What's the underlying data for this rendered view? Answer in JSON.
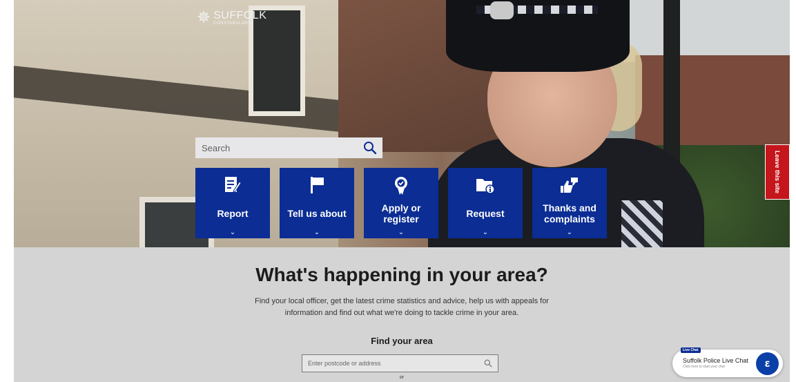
{
  "brand": {
    "name": "SUFFOLK",
    "subname": "CONSTABULARY",
    "crest_icon": "police-crest-icon"
  },
  "search": {
    "placeholder": "Search",
    "icon": "search-icon"
  },
  "tiles": [
    {
      "label": "Report",
      "icon": "report-form-icon"
    },
    {
      "label": "Tell us about",
      "icon": "flag-icon"
    },
    {
      "label": "Apply or register",
      "icon": "rosette-icon"
    },
    {
      "label": "Request",
      "icon": "folder-info-icon"
    },
    {
      "label": "Thanks and complaints",
      "icon": "thumbs-up-down-icon"
    }
  ],
  "leave_site": {
    "label": "Leave this site"
  },
  "area": {
    "heading": "What's happening in your area?",
    "description": "Find your local officer, get the latest crime statistics and advice, help us with appeals for information and find out what we're doing to tackle crime in your area.",
    "find_label": "Find your area",
    "postcode_placeholder": "Enter postcode or address",
    "or_text": "or"
  },
  "live_chat": {
    "badge": "Live Chat",
    "title": "Suffolk Police Live Chat",
    "subtitle": "Click here to start your chat"
  },
  "colors": {
    "tile_blue": "#0b2d94",
    "leave_red": "#c4161c",
    "area_grey": "#d4d4d4"
  }
}
